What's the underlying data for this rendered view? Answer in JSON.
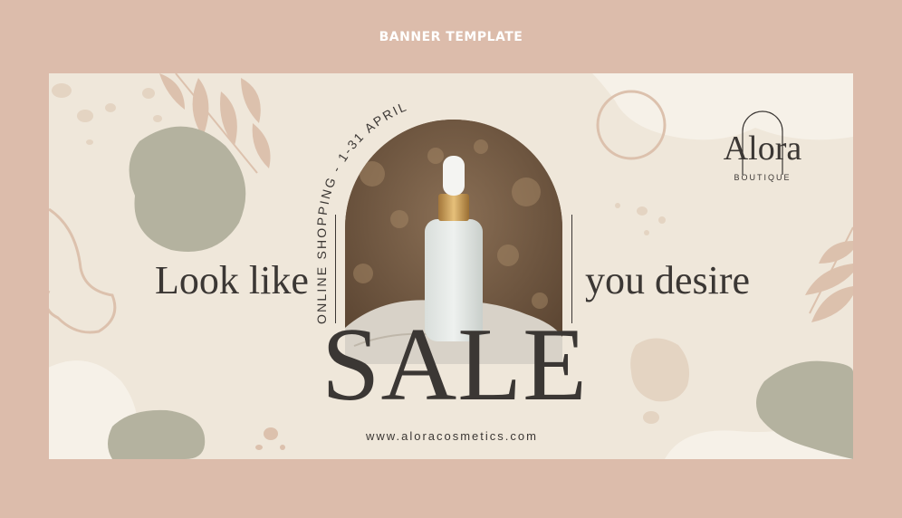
{
  "page_title": "BANNER TEMPLATE",
  "banner": {
    "arch_caption": "ONLINE SHOPPING - 1-31 APRIL",
    "tagline_left": "Look like",
    "tagline_right": "you desire",
    "headline": "SALE",
    "website": "www.aloracosmetics.com",
    "logo": {
      "name": "Alora",
      "subtitle": "BOUTIQUE"
    },
    "photo": "serum-dropper-bottle-on-stone-with-dried-flowers"
  },
  "colors": {
    "frame": "#dcbcab",
    "background": "#efe7da",
    "text": "#3b3734",
    "sage": "#b4b29f",
    "blush": "#dcc1ad",
    "sand": "#e4d4c2"
  }
}
